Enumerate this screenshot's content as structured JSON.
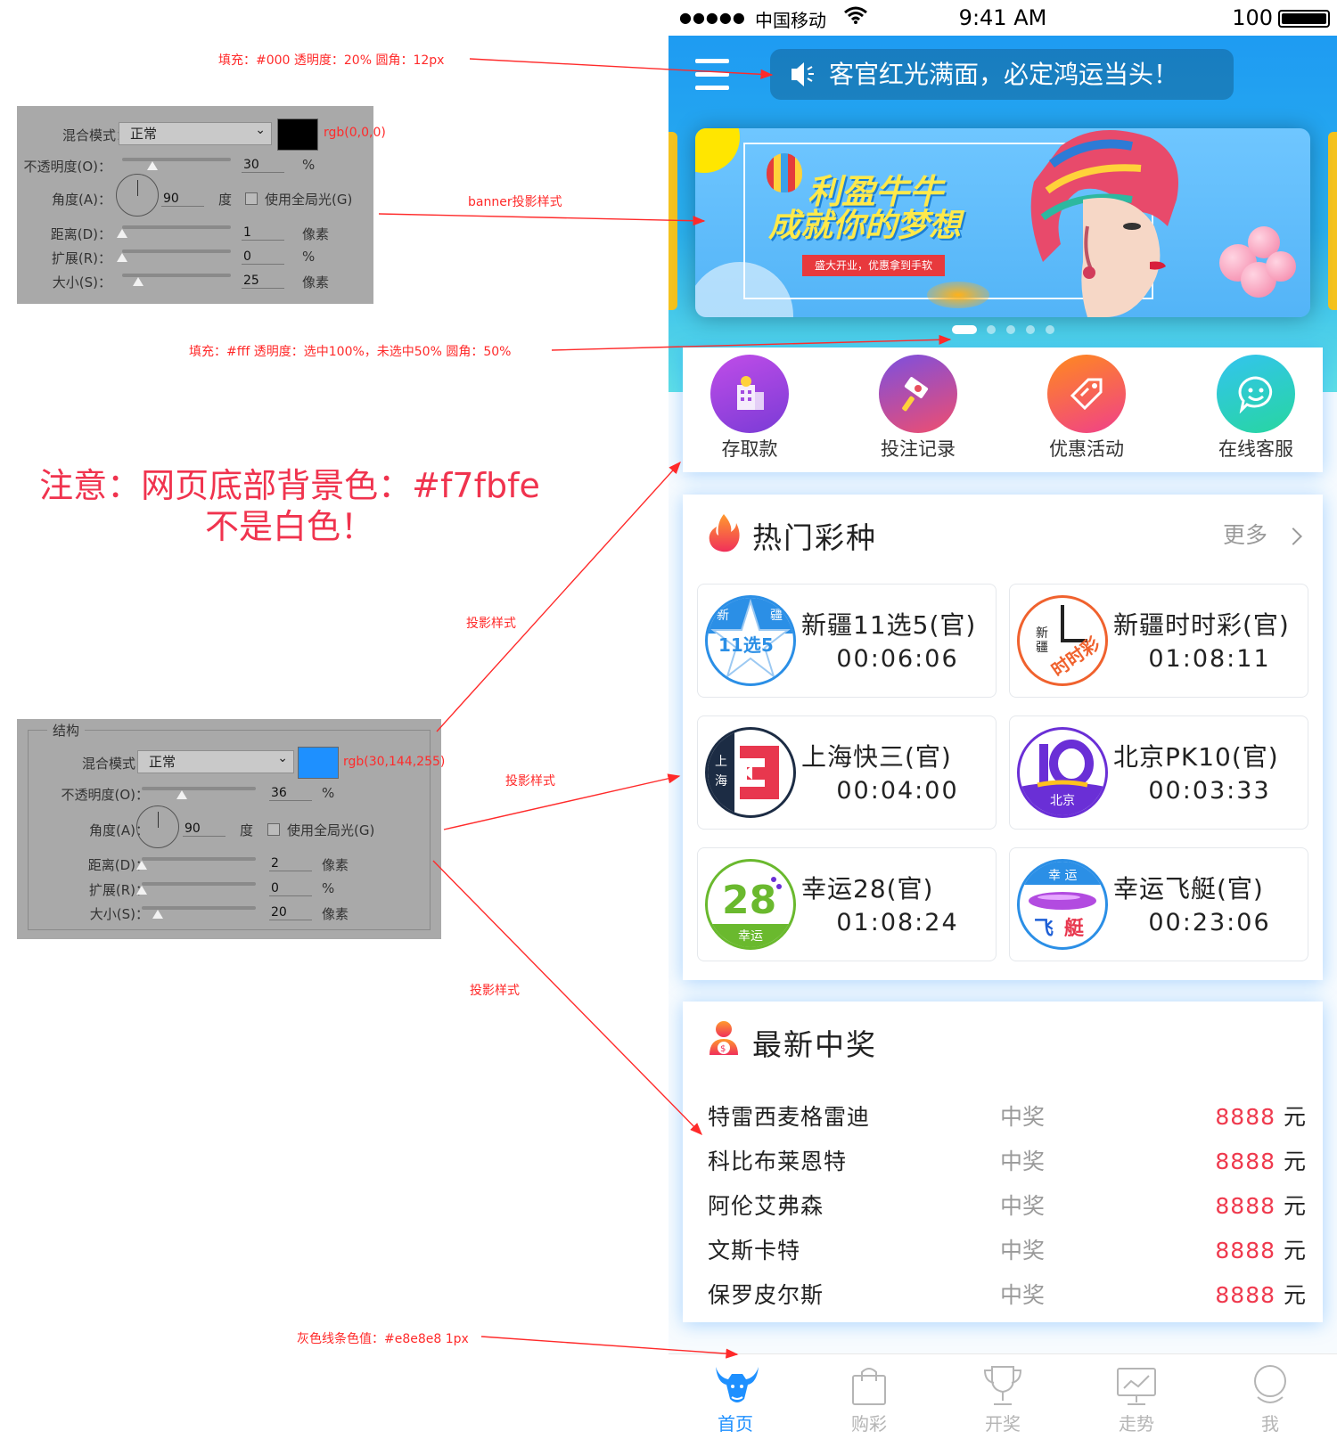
{
  "annotations": {
    "notice_spec": "填充：#000  透明度：20%   圆角：12px",
    "banner_shadow": "banner投影样式",
    "dots_spec": "填充：#fff  透明度：选中100%，未选中50%   圆角：50%",
    "bg_note_line1": "注意：网页底部背景色：#f7fbfe",
    "bg_note_line2": "不是白色！",
    "shadow_label_1": "投影样式",
    "shadow_label_2": "投影样式",
    "shadow_label_3": "投影样式",
    "divider_spec": "灰色线条色值：#e8e8e8   1px"
  },
  "ps_panel_1": {
    "blend_label": "混合模式：",
    "blend_value": "正常",
    "color_text": "rgb(0,0,0)",
    "color_hex": "#000000",
    "opacity_label": "不透明度(O)：",
    "opacity_value": "30",
    "opacity_unit": "%",
    "angle_label": "角度(A)：",
    "angle_value": "90",
    "angle_unit": "度",
    "global_light": "使用全局光(G)",
    "distance_label": "距离(D)：",
    "distance_value": "1",
    "distance_unit": "像素",
    "spread_label": "扩展(R)：",
    "spread_value": "0",
    "spread_unit": "%",
    "size_label": "大小(S)：",
    "size_value": "25",
    "size_unit": "像素"
  },
  "ps_panel_2": {
    "group_title": "结构",
    "blend_label": "混合模式：",
    "blend_value": "正常",
    "color_text": "rgb(30,144,255)",
    "color_hex": "#1e90ff",
    "opacity_label": "不透明度(O)：",
    "opacity_value": "36",
    "opacity_unit": "%",
    "angle_label": "角度(A)：",
    "angle_value": "90",
    "angle_unit": "度",
    "global_light": "使用全局光(G)",
    "distance_label": "距离(D)：",
    "distance_value": "2",
    "distance_unit": "像素",
    "spread_label": "扩展(R)：",
    "spread_value": "0",
    "spread_unit": "%",
    "size_label": "大小(S)：",
    "size_value": "20",
    "size_unit": "像素"
  },
  "status_bar": {
    "signal": "●●●●●",
    "carrier": "中国移动",
    "wifi_icon": "wifi-icon",
    "time": "9:41 AM",
    "battery": "100"
  },
  "header": {
    "menu_icon": "hamburger-menu-icon",
    "notice_icon": "speaker-icon",
    "notice_text": "客官红光满面，必定鸿运当头！"
  },
  "banner": {
    "headline_1": "利盈牛牛",
    "headline_2": "成就你的梦想",
    "ribbon": "盛大开业，优惠拿到手软",
    "slide_count": 5,
    "active_slide": 0
  },
  "quick_actions": [
    {
      "label": "存取款",
      "icon": "building-icon",
      "color_a": "#c04de8",
      "color_b": "#7a3bd6"
    },
    {
      "label": "投注记录",
      "icon": "hammer-icon",
      "color_a": "#7b4fe0",
      "color_b": "#f04e6e"
    },
    {
      "label": "优惠活动",
      "icon": "tag-icon",
      "color_a": "#ff8a1e",
      "color_b": "#f0408a"
    },
    {
      "label": "在线客服",
      "icon": "smile-chat-icon",
      "color_a": "#33c4ef",
      "color_b": "#27d6a0"
    }
  ],
  "hot_games": {
    "title": "热门彩种",
    "title_icon": "flame-icon",
    "more_label": "更多",
    "more_icon": "chevron-right-icon",
    "items": [
      {
        "name": "新疆11选5(官)",
        "time": "00:06:06",
        "logo_text": "11选5"
      },
      {
        "name": "新疆时时彩(官)",
        "time": "01:08:11",
        "logo_text": "时时彩"
      },
      {
        "name": "上海快三(官)",
        "time": "00:04:00",
        "logo_text": "上海"
      },
      {
        "name": "北京PK10(官)",
        "time": "00:03:33",
        "logo_text": "北京"
      },
      {
        "name": "幸运28(官)",
        "time": "01:08:24",
        "logo_text": "幸运"
      },
      {
        "name": "幸运飞艇(官)",
        "time": "00:23:06",
        "logo_text": "飞艇"
      }
    ]
  },
  "winners": {
    "title": "最新中奖",
    "title_icon": "winner-user-icon",
    "rows": [
      {
        "name": "特雷西麦格雷迪",
        "status": "中奖",
        "amount": "8888",
        "unit": "元"
      },
      {
        "name": "科比布莱恩特",
        "status": "中奖",
        "amount": "8888",
        "unit": "元"
      },
      {
        "name": "阿伦艾弗森",
        "status": "中奖",
        "amount": "8888",
        "unit": "元"
      },
      {
        "name": "文斯卡特",
        "status": "中奖",
        "amount": "8888",
        "unit": "元"
      },
      {
        "name": "保罗皮尔斯",
        "status": "中奖",
        "amount": "8888",
        "unit": "元"
      }
    ]
  },
  "tab_bar": [
    {
      "label": "首页",
      "icon": "bull-home-icon",
      "active": true
    },
    {
      "label": "购彩",
      "icon": "shopping-bag-icon",
      "active": false
    },
    {
      "label": "开奖",
      "icon": "trophy-icon",
      "active": false
    },
    {
      "label": "走势",
      "icon": "trend-chart-icon",
      "active": false
    },
    {
      "label": "我",
      "icon": "user-profile-icon",
      "active": false
    }
  ],
  "colors": {
    "page_bg": "#f7fbfe",
    "accent": "#1e90ff",
    "amount_red": "#ef3a4e",
    "divider": "#e8e8e8"
  }
}
